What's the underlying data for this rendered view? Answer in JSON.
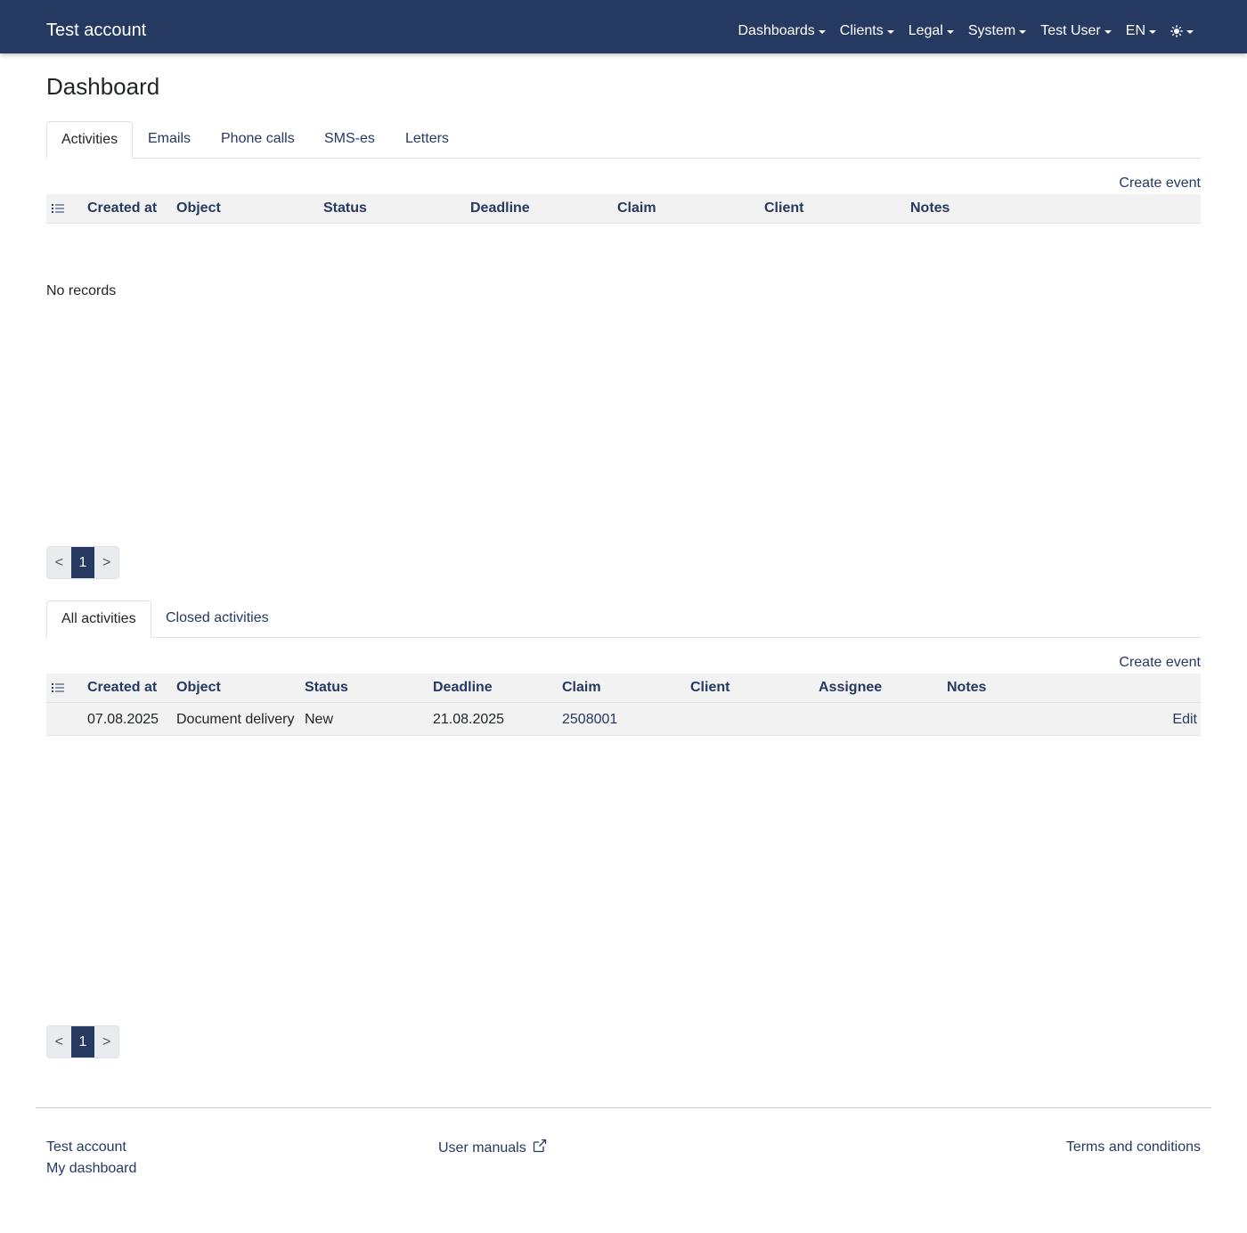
{
  "navbar": {
    "brand": "Test account",
    "menu": [
      {
        "label": "Dashboards"
      },
      {
        "label": "Clients"
      },
      {
        "label": "Legal"
      },
      {
        "label": "System"
      },
      {
        "label": "Test User"
      },
      {
        "label": "EN"
      }
    ],
    "theme_icon": "sun-icon"
  },
  "page": {
    "title": "Dashboard"
  },
  "top_tabs": [
    "Activities",
    "Emails",
    "Phone calls",
    "SMS-es",
    "Letters"
  ],
  "top_section": {
    "create_label": "Create event",
    "columns": [
      "Created at",
      "Object",
      "Status",
      "Deadline",
      "Claim",
      "Client",
      "Notes"
    ],
    "empty_text": "No records",
    "pager": {
      "prev": "<",
      "page": "1",
      "next": ">"
    }
  },
  "bottom_tabs": [
    "All activities",
    "Closed activities"
  ],
  "bottom_section": {
    "create_label": "Create event",
    "columns": [
      "Created at",
      "Object",
      "Status",
      "Deadline",
      "Claim",
      "Client",
      "Assignee",
      "Notes"
    ],
    "rows": [
      {
        "created_at": "07.08.2025",
        "object": "Document delivery",
        "status": "New",
        "deadline": "21.08.2025",
        "claim": "2508001",
        "client": "",
        "assignee": "",
        "notes": "",
        "action": "Edit"
      }
    ],
    "pager": {
      "prev": "<",
      "page": "1",
      "next": ">"
    }
  },
  "footer": {
    "account": "Test account",
    "dashboard": "My dashboard",
    "manuals": "User manuals",
    "terms": "Terms and conditions"
  },
  "colors": {
    "navbar_bg": "#263961",
    "link": "#263961",
    "header_row_bg": "#f2f2f2"
  }
}
